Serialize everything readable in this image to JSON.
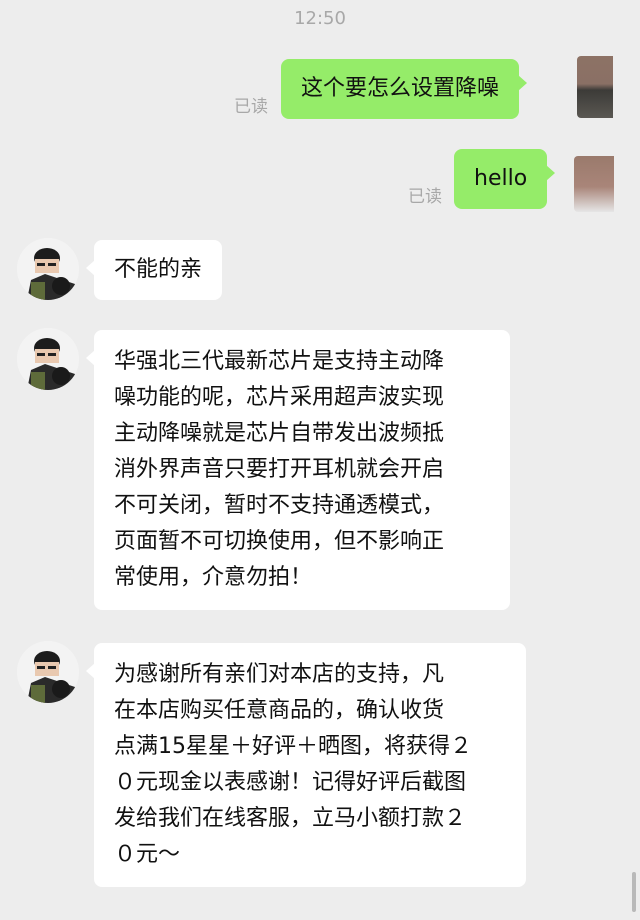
{
  "header": {
    "time": "12:50"
  },
  "messages": [
    {
      "side": "right",
      "status": "已读",
      "text": "这个要怎么设置降噪"
    },
    {
      "side": "right",
      "status": "已读",
      "text": "hello"
    },
    {
      "side": "left",
      "text": "不能的亲"
    },
    {
      "side": "left",
      "lines": [
        "华强北三代最新芯片是支持主动降",
        "噪功能的呢，芯片采用超声波实现",
        "主动降噪就是芯片自带发出波频抵",
        "消外界声音只要打开耳机就会开启",
        "不可关闭，暂时不支持通透模式，",
        "页面暂不可切换使用，但不影响正",
        "常使用，介意勿拍！"
      ]
    },
    {
      "side": "left",
      "lines": [
        "为感谢所有亲们对本店的支持，凡",
        "在本店购买任意商品的，确认收货",
        "点满15星星＋好评＋晒图，将获得２",
        "０元现金以表感谢！记得好评后截图",
        "发给我们在线客服，立马小额打款２",
        "０元～"
      ]
    }
  ],
  "colors": {
    "background": "#ededed",
    "outgoing_bubble": "#95ec69",
    "incoming_bubble": "#ffffff",
    "status_text": "#a8a8a8"
  },
  "icons": {
    "contact_avatar": "cartoon-person-avatar",
    "user_avatar": "blurred-photo-avatar"
  }
}
